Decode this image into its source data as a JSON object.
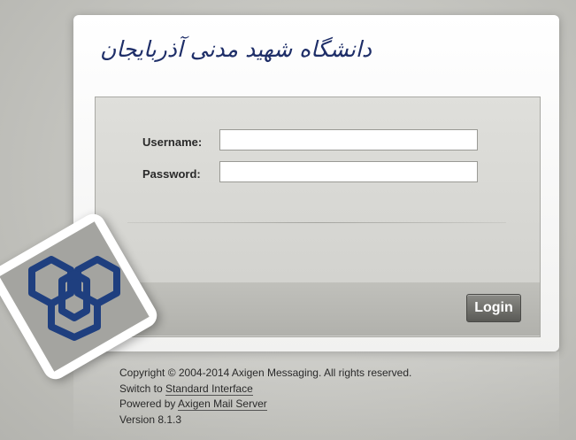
{
  "branding": {
    "university_name": "دانشگاه شهید مدنی آذربایجان",
    "emblem_icon": "university-hexagon-emblem-icon",
    "emblem_color": "#1f3f7f"
  },
  "login_form": {
    "username_label": "Username:",
    "username_value": "",
    "password_label": "Password:",
    "password_value": "",
    "login_button": "Login"
  },
  "footer": {
    "copyright": "Copyright © 2004-2014 Axigen Messaging. All rights reserved.",
    "switch_prefix": "Switch to ",
    "switch_link": "Standard Interface",
    "powered_prefix": "Powered by ",
    "powered_link": "Axigen Mail Server",
    "version": "Version 8.1.3"
  }
}
